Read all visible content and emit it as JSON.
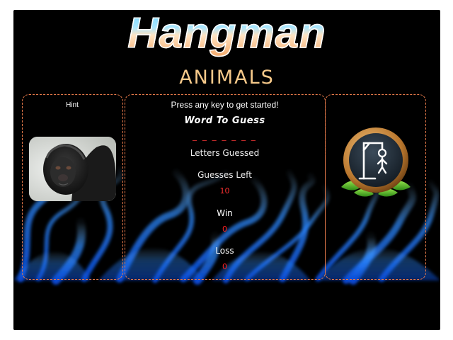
{
  "game": {
    "title": "Hangman",
    "category": "ANIMALS"
  },
  "hint": {
    "label": "Hint",
    "image": "gibbon-photo"
  },
  "board": {
    "start_message": "Press any key to get started!",
    "word_heading": "Word To Guess",
    "word_blanks": "_ _ _ _ _ _ _",
    "letters_guessed_label": "Letters Guessed",
    "guesses_left_label": "Guesses Left",
    "guesses_left_value": "10",
    "win_label": "Win",
    "win_value": "0",
    "loss_label": "Loss",
    "loss_value": "0"
  },
  "colors": {
    "panel_border": "#e87a4a",
    "counter": "#ff2020",
    "flame": "#1e7bff"
  },
  "icons": {
    "gallows": "gallows-icon"
  }
}
